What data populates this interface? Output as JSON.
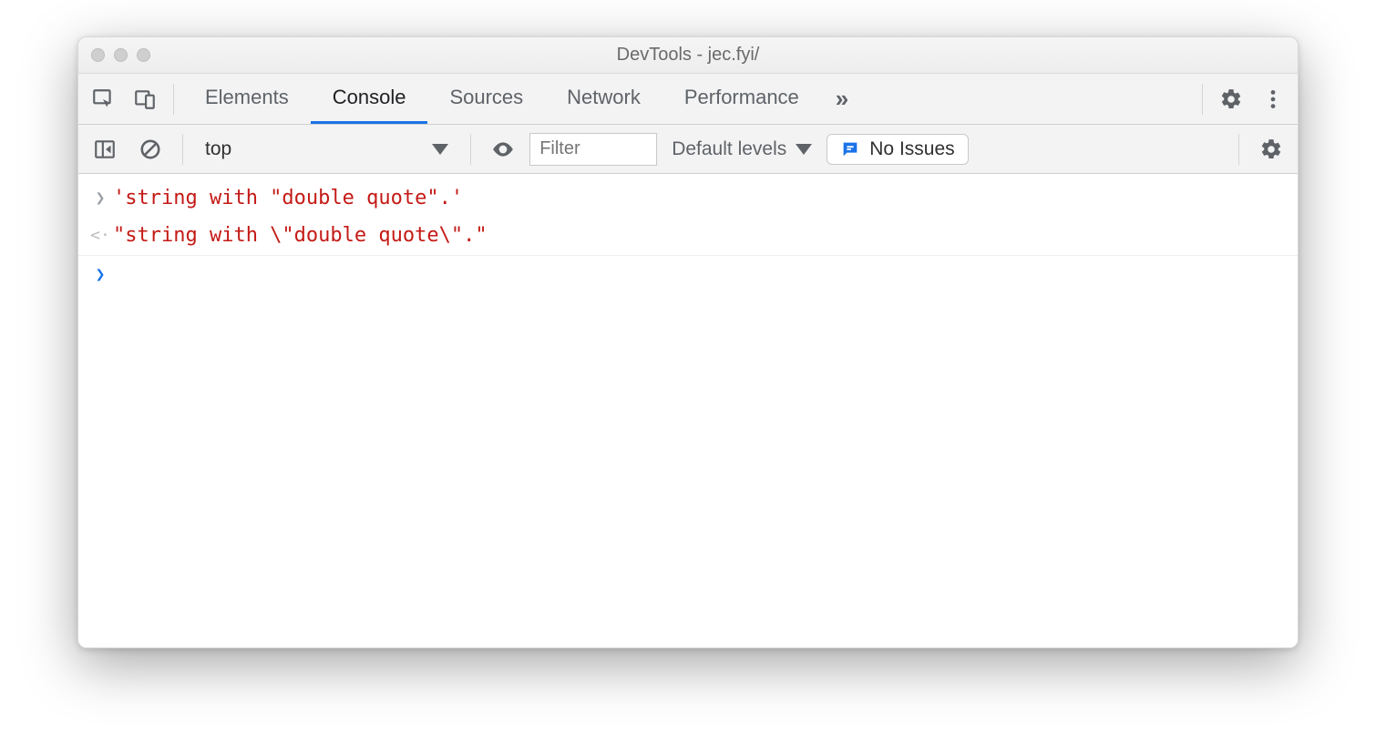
{
  "window": {
    "title": "DevTools - jec.fyi/"
  },
  "tabs": {
    "items": [
      "Elements",
      "Console",
      "Sources",
      "Network",
      "Performance"
    ],
    "active_index": 1,
    "overflow_glyph": "»"
  },
  "toolbar": {
    "context": "top",
    "filter_placeholder": "Filter",
    "levels_label": "Default levels",
    "issues_label": "No Issues"
  },
  "console": {
    "lines": [
      {
        "kind": "input",
        "text": "'string with \"double quote\".'"
      },
      {
        "kind": "output",
        "text": "\"string with \\\"double quote\\\".\""
      }
    ]
  }
}
